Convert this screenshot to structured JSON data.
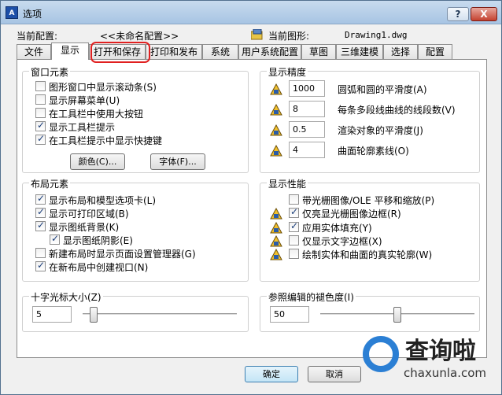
{
  "window": {
    "title": "选项",
    "help_label": "?",
    "close_label": "X"
  },
  "header": {
    "profile_label": "当前配置:",
    "profile_value": "<<未命名配置>>",
    "drawing_label": "当前图形:",
    "drawing_value": "Drawing1.dwg"
  },
  "tabs": [
    {
      "label": "文件"
    },
    {
      "label": "显示",
      "active": true
    },
    {
      "label": "打开和保存"
    },
    {
      "label": "打印和发布"
    },
    {
      "label": "系统"
    },
    {
      "label": "用户系统配置"
    },
    {
      "label": "草图"
    },
    {
      "label": "三维建模"
    },
    {
      "label": "选择"
    },
    {
      "label": "配置"
    }
  ],
  "window_elements": {
    "title": "窗口元素",
    "options": [
      {
        "label": "图形窗口中显示滚动条(S)",
        "checked": false
      },
      {
        "label": "显示屏幕菜单(U)",
        "checked": false
      },
      {
        "label": "在工具栏中使用大按钮",
        "checked": false
      },
      {
        "label": "显示工具栏提示",
        "checked": true
      },
      {
        "label": "在工具栏提示中显示快捷键",
        "checked": true
      }
    ],
    "colors_button": "颜色(C)...",
    "fonts_button": "字体(F)..."
  },
  "display_resolution": {
    "title": "显示精度",
    "items": [
      {
        "value": "1000",
        "label": "圆弧和圆的平滑度(A)"
      },
      {
        "value": "8",
        "label": "每条多段线曲线的线段数(V)"
      },
      {
        "value": "0.5",
        "label": "渲染对象的平滑度(J)"
      },
      {
        "value": "4",
        "label": "曲面轮廓素线(O)"
      }
    ]
  },
  "layout_elements": {
    "title": "布局元素",
    "options": [
      {
        "label": "显示布局和模型选项卡(L)",
        "checked": true
      },
      {
        "label": "显示可打印区域(B)",
        "checked": true
      },
      {
        "label": "显示图纸背景(K)",
        "checked": true
      },
      {
        "label": "显示图纸阴影(E)",
        "checked": true
      },
      {
        "label": "新建布局时显示页面设置管理器(G)",
        "checked": false
      },
      {
        "label": "在新布局中创建视口(N)",
        "checked": true
      }
    ]
  },
  "display_performance": {
    "title": "显示性能",
    "options": [
      {
        "label": "带光栅图像/OLE 平移和缩放(P)",
        "checked": false
      },
      {
        "label": "仅亮显光栅图像边框(R)",
        "checked": true
      },
      {
        "label": "应用实体填充(Y)",
        "checked": true
      },
      {
        "label": "仅显示文字边框(X)",
        "checked": false
      },
      {
        "label": "绘制实体和曲面的真实轮廓(W)",
        "checked": false
      }
    ]
  },
  "crosshair": {
    "title": "十字光标大小(Z)",
    "value": "5",
    "fraction": 0.05
  },
  "xref_fade": {
    "title": "参照编辑的褪色度(I)",
    "value": "50",
    "fraction": 0.5
  },
  "footer": {
    "ok": "确定",
    "cancel": "取消"
  },
  "watermark": {
    "text": "查询啦",
    "url": "chaxunla.com"
  }
}
